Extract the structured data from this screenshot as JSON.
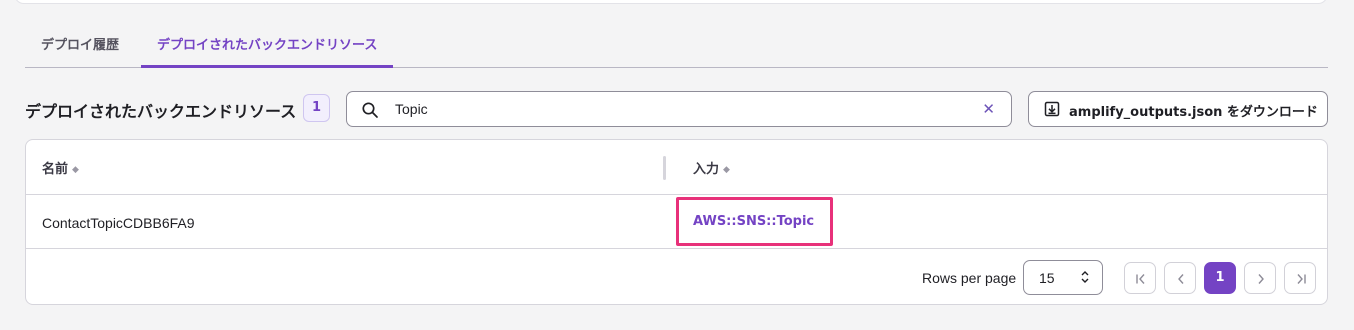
{
  "tabs": [
    {
      "label": "デプロイ履歴",
      "active": false
    },
    {
      "label": "デプロイされたバックエンドリソース",
      "active": true
    }
  ],
  "section": {
    "title": "デプロイされたバックエンドリソース",
    "count": "1"
  },
  "search": {
    "value": "Topic",
    "icon": "search-icon",
    "clear_icon": "close-icon"
  },
  "download": {
    "label": "amplify_outputs.json をダウンロード",
    "icon": "download-icon"
  },
  "table": {
    "columns": [
      {
        "label": "名前",
        "sort_icon": "sort-icon"
      },
      {
        "label": "入力",
        "sort_icon": "sort-icon"
      }
    ],
    "rows": [
      {
        "name": "ContactTopicCDBB6FA9",
        "type": "AWS::SNS::Topic"
      }
    ]
  },
  "pagination": {
    "rows_per_page_label": "Rows per page",
    "rows_per_page_value": "15",
    "current_page": "1"
  },
  "colors": {
    "accent": "#7443c4",
    "highlight": "#e8317a"
  }
}
